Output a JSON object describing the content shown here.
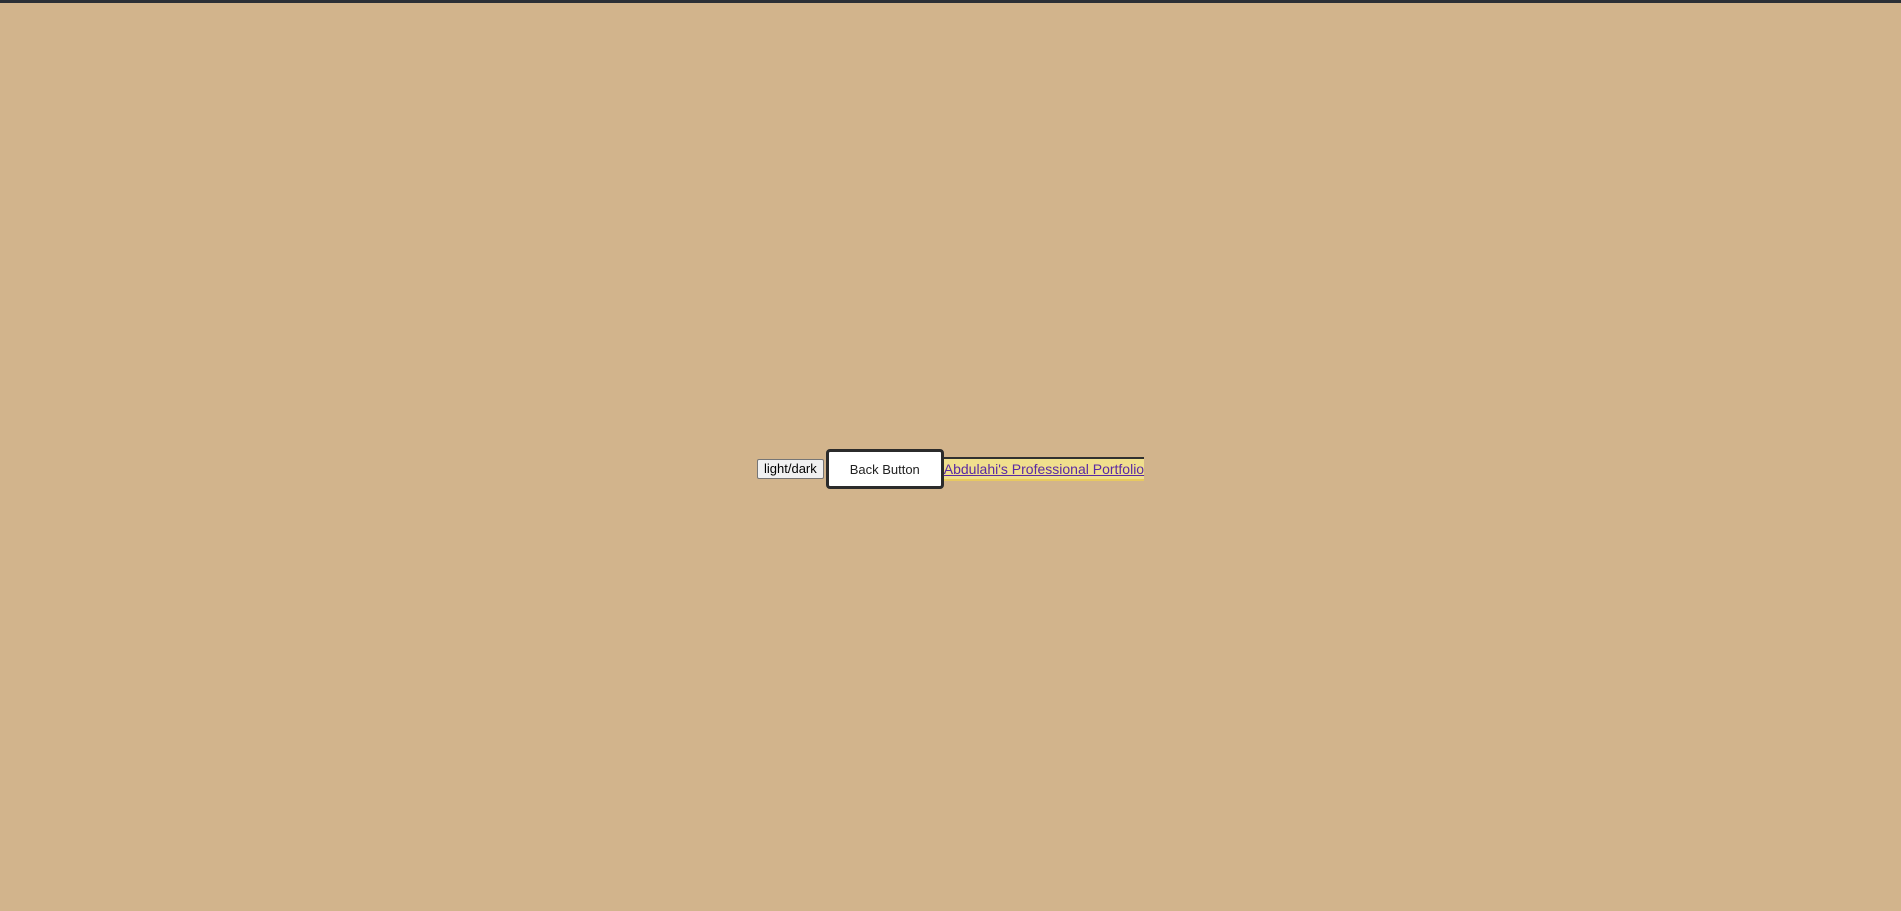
{
  "page": {
    "background_color": "#d2b48c",
    "top_strip_color": "#2b2f35"
  },
  "controls": {
    "theme_toggle_label": "light/dark",
    "back_button_label": "Back Button",
    "portfolio_link_text": "Abdulahi's Professional Portfolio"
  }
}
